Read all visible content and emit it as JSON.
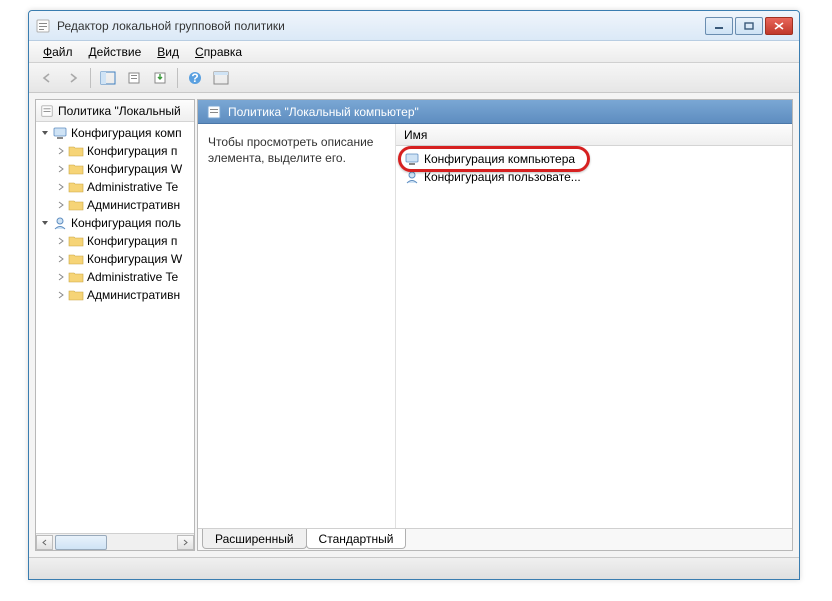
{
  "window": {
    "title": "Редактор локальной групповой политики"
  },
  "menubar": {
    "file": "Файл",
    "action": "Действие",
    "view": "Вид",
    "help": "Справка"
  },
  "tree": {
    "header": "Политика \"Локальный",
    "roots": [
      {
        "label": "Конфигурация комп",
        "children": [
          {
            "label": "Конфигурация п"
          },
          {
            "label": "Конфигурация W"
          },
          {
            "label": "Administrative Te"
          },
          {
            "label": "Административн"
          }
        ]
      },
      {
        "label": "Конфигурация поль",
        "children": [
          {
            "label": "Конфигурация п"
          },
          {
            "label": "Конфигурация W"
          },
          {
            "label": "Administrative Te"
          },
          {
            "label": "Административн"
          }
        ]
      }
    ]
  },
  "detail": {
    "title": "Политика \"Локальный компьютер\"",
    "description": "Чтобы просмотреть описание элемента, выделите его.",
    "column_name": "Имя",
    "items": [
      {
        "label": "Конфигурация компьютера"
      },
      {
        "label": "Конфигурация пользовате..."
      }
    ]
  },
  "tabs": {
    "extended": "Расширенный",
    "standard": "Стандартный"
  }
}
